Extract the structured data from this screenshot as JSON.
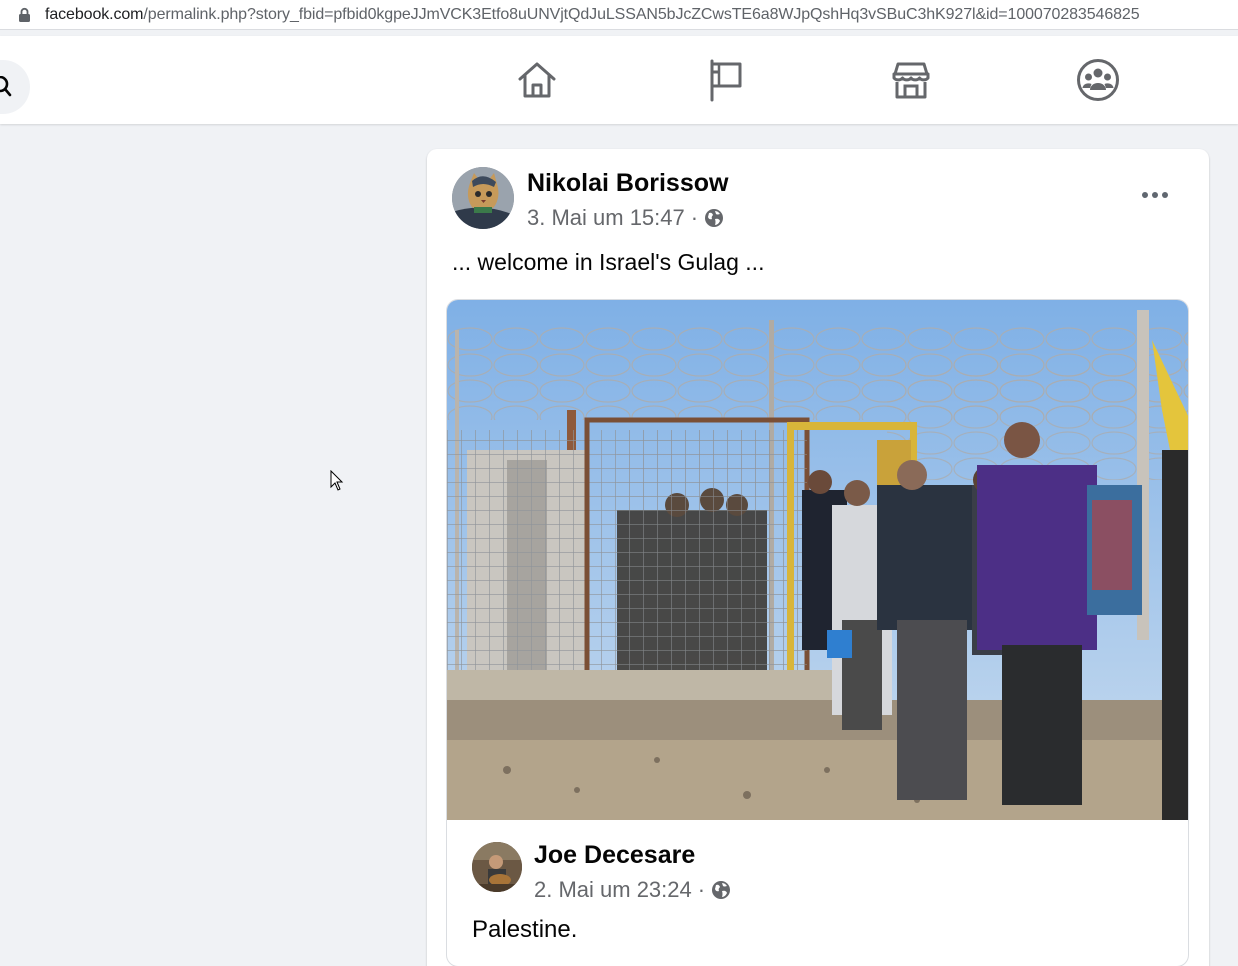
{
  "browser": {
    "url_host": "facebook.com",
    "url_rest": "/permalink.php?story_fbid=pfbid0kgpeJJmVCK3Etfo8uUNVjtQdJuLSSAN5bJcZCwsTE6a8WJpQshHq3vSBuC3hK927l&id=100070283546825"
  },
  "nav": {
    "icons": [
      "search-icon",
      "home-icon",
      "pages-flag-icon",
      "marketplace-icon",
      "groups-icon"
    ]
  },
  "post": {
    "author": "Nikolai Borissow",
    "timestamp": "3. Mai um 15:47",
    "separator": "·",
    "privacy_icon": "globe-icon",
    "text": "... welcome in Israel's Gulag ...",
    "shared": {
      "author": "Joe Decesare",
      "timestamp": "2. Mai um 23:24",
      "separator": "·",
      "privacy_icon": "globe-icon",
      "text": "Palestine."
    }
  },
  "colors": {
    "background": "#f0f2f5",
    "card": "#ffffff",
    "text_primary": "#050505",
    "text_secondary": "#65676b",
    "icon": "#65676b"
  }
}
